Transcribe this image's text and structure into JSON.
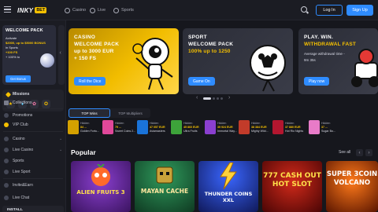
{
  "header": {
    "logo": "INKY",
    "logo_badge": "BET",
    "tabs": [
      "Casino",
      "Live",
      "Sports"
    ],
    "login": "Log In",
    "signup": "Sign Up"
  },
  "sidebar": {
    "promo": {
      "title": "WELCOME PACK",
      "lines": [
        "Activate",
        "$2000, up to $5000 BONUS",
        "in Sports",
        "+100 FS",
        "+ 100% to"
      ],
      "button": "Get Bonus"
    },
    "missions": {
      "title": "Missions",
      "icons": [
        "★",
        "♦",
        "✿",
        "✪"
      ]
    },
    "items": [
      {
        "label": "Collections"
      },
      {
        "label": "Promotions"
      },
      {
        "label": "VIP Club"
      },
      {
        "label": "Casino",
        "expandable": true
      },
      {
        "label": "Live Casino",
        "expandable": true
      },
      {
        "label": "Sports"
      },
      {
        "label": "Live Sport"
      },
      {
        "label": "Invite&Earn"
      },
      {
        "label": "Live Chat"
      }
    ],
    "install": "INSTALL"
  },
  "banners": [
    {
      "tag": "CASINO",
      "line1": "WELCOME PACK",
      "line2": "up to 3000 EUR",
      "line3": "+ 150 FS",
      "button": "Roll the Dice"
    },
    {
      "tag": "SPORT",
      "line1": "WELCOME PACK",
      "line2": "100% up to 1250",
      "button": "Game On"
    },
    {
      "tag": "PLAY. WIN.",
      "line1": "WITHDRAWAL FAST",
      "sub1": "Average withdrawal time -",
      "sub2": "9m 35s",
      "button": "Play now"
    }
  ],
  "carousel_progress": 0.25,
  "wins_tabs": [
    "TOP Wins",
    "TOP Multipliers"
  ],
  "wins": [
    {
      "user": "Hidden",
      "amount": "84 ...",
      "game": "Golden Fortu..."
    },
    {
      "user": "Hidden",
      "amount": "79 ...",
      "game": "Sweet Coins 2..."
    },
    {
      "user": "Hidden",
      "amount": "47 057 EUR",
      "game": "Aviamasters"
    },
    {
      "user": "Hidden",
      "amount": "45 860 EUR",
      "game": "Ultra Fruits"
    },
    {
      "user": "Hidden",
      "amount": "39 924 EUR",
      "game": "Immortal Way..."
    },
    {
      "user": "Hidden",
      "amount": "38 384 EUR",
      "game": "Mighty Wild..."
    },
    {
      "user": "Hidden",
      "amount": "37 880 EUR",
      "game": "Hot Rio Nights"
    },
    {
      "user": "Hidden",
      "amount": "37 ...",
      "game": "Sugar Bo..."
    }
  ],
  "popular": {
    "title": "Popular",
    "see_all": "See all",
    "games": [
      {
        "name": "ALIEN FRUITS 3",
        "bg": "#4a1a66"
      },
      {
        "name": "MAYAN CACHE",
        "bg": "#1d5a3a"
      },
      {
        "name": "THUNDER COINS XXL",
        "bg": "#1a2a7a"
      },
      {
        "name": "777 CASH OUT HOT SLOT",
        "bg": "#7a1010"
      },
      {
        "name": "SUPER 3COIN VOLCANO",
        "bg": "#8a2a00"
      }
    ]
  }
}
